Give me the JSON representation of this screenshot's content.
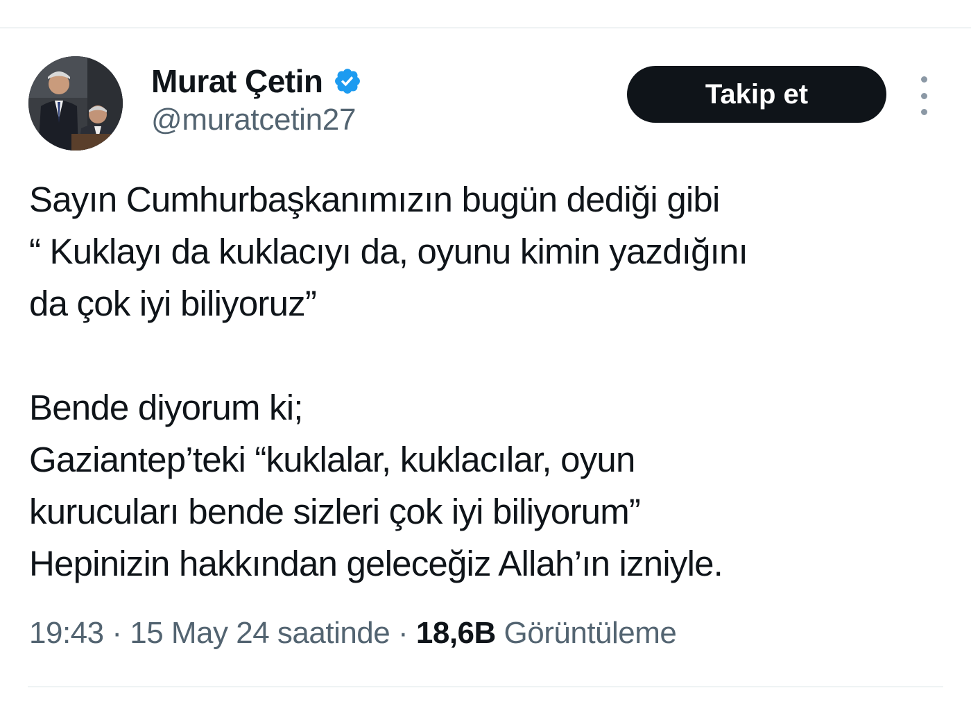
{
  "tweet": {
    "author": {
      "display_name": "Murat Çetin",
      "handle": "@muratcetin27",
      "verified_icon": "verified-badge-icon",
      "avatar_icon": "profile-photo"
    },
    "follow_label": "Takip et",
    "more_icon": "more-vertical-icon",
    "text_lines": [
      "Sayın Cumhurbaşkanımızın bugün dediği gibi",
      "“ Kuklayı da kuklacıyı da, oyunu kimin yazdığını",
      "da çok iyi biliyoruz”",
      "",
      "Bende diyorum ki;",
      "Gaziantep’teki “kuklalar, kuklacılar, oyun",
      "kurucuları bende sizleri çok iyi biliyorum”",
      "Hepinizin hakkından geleceğiz Allah’ın izniyle."
    ],
    "meta": {
      "time": "19:43",
      "separator": " · ",
      "date": "15 May 24 saatinde",
      "views_count": "18,6B",
      "views_label": "Görüntüleme"
    }
  },
  "colors": {
    "text_primary": "#0f1419",
    "text_secondary": "#536471",
    "verified": "#1d9bf0",
    "follow_bg": "#0f1419",
    "divider": "#eff3f4"
  }
}
